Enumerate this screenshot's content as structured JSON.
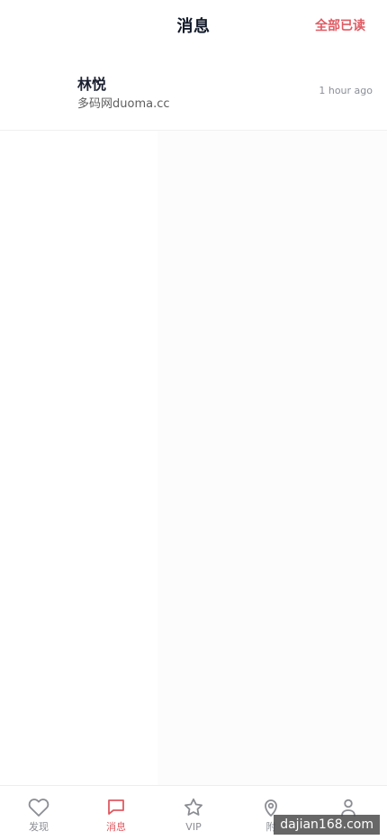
{
  "header": {
    "title": "消息",
    "action_label": "全部已读"
  },
  "messages": [
    {
      "name": "林悦",
      "preview": "多码网duoma.cc",
      "time": "1 hour ago"
    }
  ],
  "bottom_nav": {
    "items": [
      {
        "label": "发现",
        "icon": "heart-icon",
        "active": false
      },
      {
        "label": "消息",
        "icon": "message-icon",
        "active": true
      },
      {
        "label": "VIP",
        "icon": "star-icon",
        "active": false
      },
      {
        "label": "附",
        "icon": "location-icon",
        "active": false
      },
      {
        "label": "",
        "icon": "user-icon",
        "active": false
      }
    ]
  },
  "watermark": "dajian168.com",
  "colors": {
    "accent": "#e05a62",
    "text_primary": "#121a2a",
    "text_secondary": "#8b8f98"
  }
}
